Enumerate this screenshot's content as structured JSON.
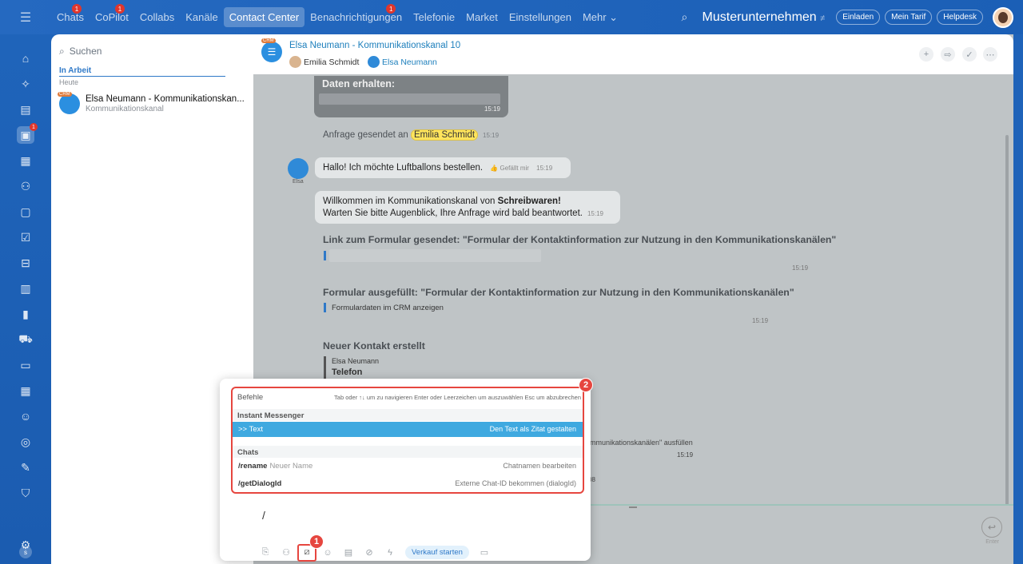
{
  "topnav": {
    "items": [
      {
        "label": "Chats",
        "badge": "1"
      },
      {
        "label": "CoPilot",
        "badge": "1"
      },
      {
        "label": "Collabs",
        "badge": ""
      },
      {
        "label": "Kanäle",
        "badge": ""
      },
      {
        "label": "Contact Center",
        "badge": ""
      },
      {
        "label": "Benachrichtigungen",
        "badge": "1"
      },
      {
        "label": "Telefonie",
        "badge": ""
      },
      {
        "label": "Market",
        "badge": ""
      },
      {
        "label": "Einstellungen",
        "badge": ""
      },
      {
        "label": "Mehr ⌄",
        "badge": ""
      }
    ],
    "company": "Musterunternehmen",
    "company_suffix": "≠",
    "invite": "Einladen",
    "plan": "Mein Tarif",
    "helpdesk": "Helpdesk"
  },
  "sidebar": {
    "chat_badge": "1",
    "profile_letter": "s"
  },
  "recent": {
    "search_placeholder": "Suchen",
    "group": "In Arbeit",
    "date": "Heute",
    "items": [
      {
        "title": "Elsa Neumann - Kommunikationskan...",
        "subtitle": "Kommunikationskanal",
        "tag": "CRM"
      }
    ]
  },
  "chat": {
    "title": "Elsa Neumann - Kommunikationskanal 10",
    "tag": "CRM",
    "members": [
      "Emilia Schmidt",
      "Elsa Neumann"
    ],
    "messages": {
      "data_title": "Daten erhalten:",
      "data_time": "15:19",
      "request_prefix": "Anfrage gesendet an",
      "request_name": "Emilia Schmidt",
      "request_time": "15:19",
      "hello": "Hallo! Ich möchte Luftballons bestellen.",
      "hello_like": "👍 Gefällt mir",
      "hello_time": "15:19",
      "sender": "Elsa",
      "welcome_prefix": "Willkommen im Kommunikationskanal von",
      "welcome_company": "Schreibwaren!",
      "welcome_line2": "Warten Sie bitte Augenblick, Ihre Anfrage wird bald beantwortet.",
      "welcome_time": "15:19",
      "form_link": "Link zum Formular gesendet: \"Formular der Kontaktinformation zur Nutzung in den Kommunikationskanälen\"",
      "form_link_time": "15:19",
      "form_filled": "Formular ausgefüllt: \"Formular der Kontaktinformation zur Nutzung in den Kommunikationskanälen\"",
      "form_filled_sub": "Formulardaten im CRM anzeigen",
      "form_filled_time": "15:19",
      "contact_title": "Neuer Kontakt erstellt",
      "contact_name": "Elsa Neumann",
      "contact_phone": "Telefon",
      "bg_fill": "mmunikationskanälen\" ausfüllen",
      "bg_time": "15:19",
      "bg_time2": "08"
    },
    "enter_label": "Enter"
  },
  "composer": {
    "text": "/",
    "sale_chip": "Verkauf starten"
  },
  "commands": {
    "header": "Befehle",
    "hint_nav": "Tab oder ↑↓ um zu navigieren",
    "hint_select": "Enter oder Leerzeichen um auszuwählen",
    "hint_cancel": "Esc um abzubrechen",
    "sections": [
      {
        "title": "Instant Messenger",
        "items": [
          {
            "cmd": ">> Text",
            "param": "",
            "desc": "Den Text als Zitat gestalten"
          }
        ]
      },
      {
        "title": "Chats",
        "items": [
          {
            "cmd": "/rename",
            "param": "Neuer Name",
            "desc": "Chatnamen bearbeiten"
          },
          {
            "cmd": "/getDialogId",
            "param": "",
            "desc": "Externe Chat-ID bekommen (dialogId)"
          }
        ]
      }
    ]
  },
  "annotations": {
    "marker1": "1",
    "marker2": "2"
  },
  "colors": {
    "accent": "#2f79c8",
    "selected_row": "#3fa9e0",
    "highlight": "#e6463f",
    "nav_bg": "#1f63b9"
  }
}
